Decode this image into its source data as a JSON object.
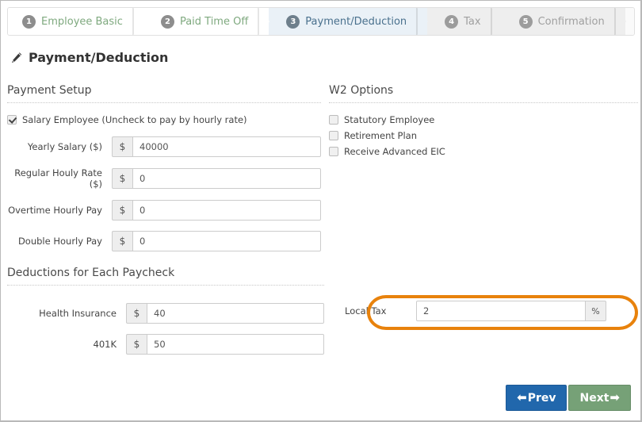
{
  "wizard": {
    "steps": [
      {
        "num": "1",
        "label": "Employee Basic",
        "state": "done"
      },
      {
        "num": "2",
        "label": "Paid Time Off",
        "state": "done"
      },
      {
        "num": "3",
        "label": "Payment/Deduction",
        "state": "active"
      },
      {
        "num": "4",
        "label": "Tax",
        "state": "todo"
      },
      {
        "num": "5",
        "label": "Confirmation",
        "state": "todo"
      }
    ]
  },
  "header": {
    "title": "Payment/Deduction",
    "icon": "pencil-icon"
  },
  "payment_setup": {
    "section_title": "Payment Setup",
    "salary_checkbox": {
      "label": "Salary Employee (Uncheck to pay by hourly rate)",
      "checked": true
    },
    "fields": [
      {
        "label": "Yearly Salary ($)",
        "prefix": "$",
        "value": "40000"
      },
      {
        "label": "Regular Houly Rate ($)",
        "prefix": "$",
        "value": "0"
      },
      {
        "label": "Overtime Hourly Pay",
        "prefix": "$",
        "value": "0"
      },
      {
        "label": "Double Hourly Pay",
        "prefix": "$",
        "value": "0"
      }
    ]
  },
  "w2_options": {
    "section_title": "W2 Options",
    "items": [
      {
        "label": "Statutory Employee",
        "checked": false
      },
      {
        "label": "Retirement Plan",
        "checked": false
      },
      {
        "label": "Receive Advanced EIC",
        "checked": false
      }
    ]
  },
  "deductions": {
    "section_title": "Deductions for Each Paycheck",
    "fields": [
      {
        "label": "Health Insurance",
        "prefix": "$",
        "value": "40"
      },
      {
        "label": "401K",
        "prefix": "$",
        "value": "50"
      }
    ]
  },
  "local_tax": {
    "label": "Local Tax",
    "value": "2",
    "suffix": "%",
    "highlight_color": "#e8820c"
  },
  "footer": {
    "prev_label": "Prev",
    "prev_arrow": "⬅",
    "prev_color": "#2167ac",
    "next_label": "Next",
    "next_arrow": "➡",
    "next_color": "#76a177"
  }
}
